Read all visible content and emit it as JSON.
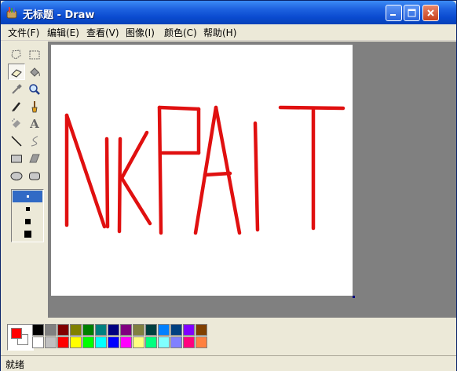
{
  "window": {
    "title": "无标题 - Draw",
    "controls": [
      "minimize-icon",
      "maximize-icon",
      "close-icon"
    ]
  },
  "menu": {
    "items": [
      {
        "label": "文件(F)"
      },
      {
        "label": "编辑(E)"
      },
      {
        "label": "查看(V)"
      },
      {
        "label": "图像(I)"
      },
      {
        "label": "颜色(C)"
      },
      {
        "label": "帮助(H)"
      }
    ]
  },
  "toolbox": {
    "tools": [
      {
        "name": "free-form-select-icon"
      },
      {
        "name": "rect-select-icon"
      },
      {
        "name": "eraser-icon",
        "selected": true
      },
      {
        "name": "fill-icon"
      },
      {
        "name": "pick-color-icon"
      },
      {
        "name": "magnifier-icon"
      },
      {
        "name": "pencil-icon"
      },
      {
        "name": "brush-icon"
      },
      {
        "name": "airbrush-icon"
      },
      {
        "name": "text-icon"
      },
      {
        "name": "line-icon"
      },
      {
        "name": "curve-icon"
      },
      {
        "name": "rectangle-icon"
      },
      {
        "name": "polygon-icon"
      },
      {
        "name": "ellipse-icon"
      },
      {
        "name": "rounded-rect-icon"
      }
    ],
    "text_tool_glyph": "A",
    "eraser_sizes": [
      1,
      2,
      3,
      4
    ],
    "selected_size_index": 0
  },
  "canvas": {
    "drawn_text": "NKPAIT",
    "stroke_color": "#e01010"
  },
  "palette": {
    "foreground": "#ff0000",
    "background": "#ffffff",
    "top_row": [
      "#000000",
      "#808080",
      "#800000",
      "#808000",
      "#008000",
      "#008080",
      "#000080",
      "#800080",
      "#808040",
      "#004040",
      "#0080ff",
      "#004080",
      "#8000ff",
      "#804000"
    ],
    "bottom_row": [
      "#ffffff",
      "#c0c0c0",
      "#ff0000",
      "#ffff00",
      "#00ff00",
      "#00ffff",
      "#0000ff",
      "#ff00ff",
      "#ffff80",
      "#00ff80",
      "#80ffff",
      "#8080ff",
      "#ff0080",
      "#ff8040"
    ]
  },
  "status": {
    "text": "就绪"
  }
}
